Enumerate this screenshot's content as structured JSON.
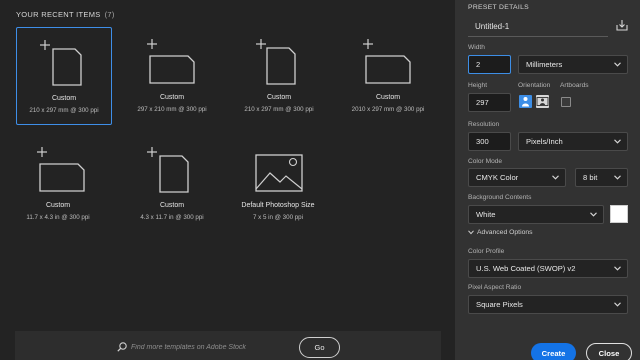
{
  "recent": {
    "header": "YOUR RECENT ITEMS",
    "count": "(7)",
    "items": [
      {
        "name": "Custom",
        "dims": "210 x 297 mm @ 300 ppi",
        "icon": "portrait-document-icon"
      },
      {
        "name": "Custom",
        "dims": "297 x 210 mm @ 300 ppi",
        "icon": "landscape-document-icon"
      },
      {
        "name": "Custom",
        "dims": "210 x 297 mm @ 300 ppi",
        "icon": "portrait-document-icon"
      },
      {
        "name": "Custom",
        "dims": "2010 x 297 mm @ 300 ppi",
        "icon": "landscape-document-icon"
      },
      {
        "name": "Custom",
        "dims": "11.7 x 4.3 in @ 300 ppi",
        "icon": "landscape-document-icon"
      },
      {
        "name": "Custom",
        "dims": "4.3 x 11.7 in @ 300 ppi",
        "icon": "portrait-document-icon"
      },
      {
        "name": "Default Photoshop Size",
        "dims": "7 x 5 in @ 300 ppi",
        "icon": "image-placeholder-icon"
      }
    ]
  },
  "stock": {
    "placeholder": "Find more templates on Adobe Stock",
    "go_label": "Go"
  },
  "preset": {
    "title": "PRESET DETAILS",
    "doc_name": "Untitled-1",
    "width_label": "Width",
    "width_value": "2",
    "width_unit": "Millimeters",
    "height_label": "Height",
    "height_value": "297",
    "orientation_label": "Orientation",
    "artboards_label": "Artboards",
    "resolution_label": "Resolution",
    "resolution_value": "300",
    "resolution_unit": "Pixels/Inch",
    "color_mode_label": "Color Mode",
    "color_mode_value": "CMYK Color",
    "bit_depth_value": "8 bit",
    "background_label": "Background Contents",
    "background_value": "White",
    "advanced_label": "Advanced Options",
    "color_profile_label": "Color Profile",
    "color_profile_value": "U.S. Web Coated (SWOP) v2",
    "pixel_aspect_label": "Pixel Aspect Ratio",
    "pixel_aspect_value": "Square Pixels"
  },
  "actions": {
    "create_label": "Create",
    "close_label": "Close"
  },
  "colors": {
    "accent": "#1473e6",
    "focus": "#3d8ee6",
    "background": "#232323",
    "panel": "#323232"
  }
}
